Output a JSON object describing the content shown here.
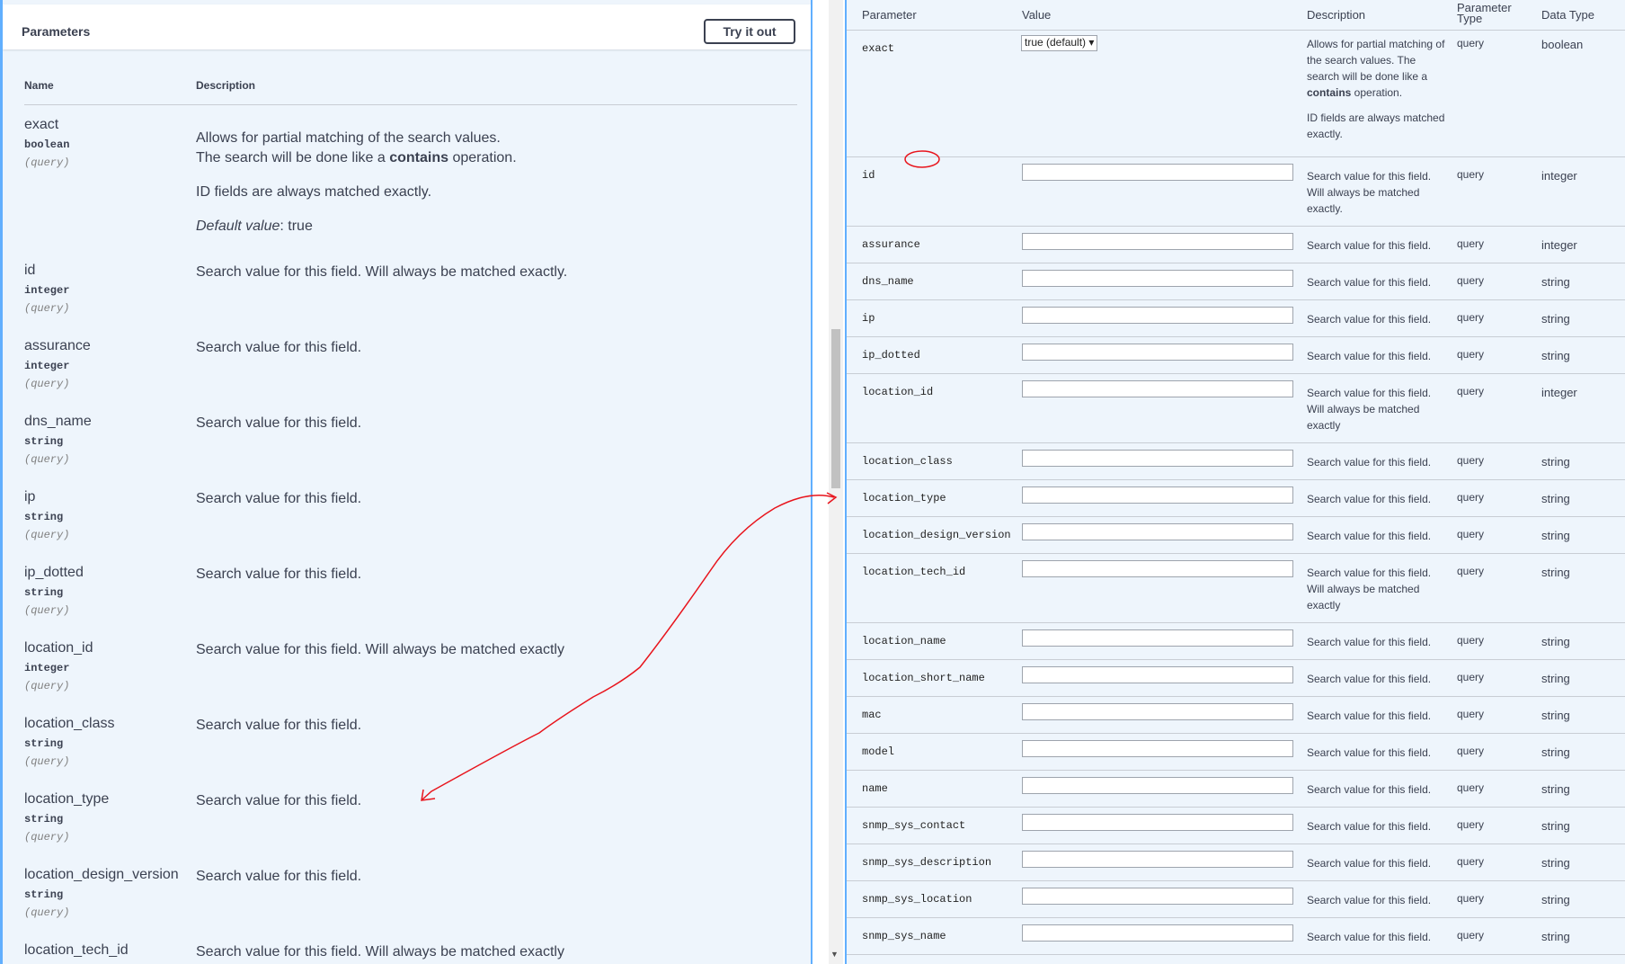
{
  "left": {
    "title": "Parameters",
    "try_button": "Try it out",
    "col_name": "Name",
    "col_description": "Description",
    "rows": [
      {
        "name": "exact",
        "type": "boolean",
        "in": "(query)",
        "desc1": "Allows for partial matching of the search values.",
        "desc2_pre": "The search will be done like a ",
        "desc2_bold": "contains",
        "desc2_post": " operation.",
        "desc3": "ID fields are always matched exactly.",
        "default_label": "Default value",
        "default_value": ": true"
      },
      {
        "name": "id",
        "type": "integer",
        "in": "(query)",
        "desc": "Search value for this field. Will always be matched exactly."
      },
      {
        "name": "assurance",
        "type": "integer",
        "in": "(query)",
        "desc": "Search value for this field."
      },
      {
        "name": "dns_name",
        "type": "string",
        "in": "(query)",
        "desc": "Search value for this field."
      },
      {
        "name": "ip",
        "type": "string",
        "in": "(query)",
        "desc": "Search value for this field."
      },
      {
        "name": "ip_dotted",
        "type": "string",
        "in": "(query)",
        "desc": "Search value for this field."
      },
      {
        "name": "location_id",
        "type": "integer",
        "in": "(query)",
        "desc": "Search value for this field. Will always be matched exactly"
      },
      {
        "name": "location_class",
        "type": "string",
        "in": "(query)",
        "desc": "Search value for this field."
      },
      {
        "name": "location_type",
        "type": "string",
        "in": "(query)",
        "desc": "Search value for this field."
      },
      {
        "name": "location_design_version",
        "type": "string",
        "in": "(query)",
        "desc": "Search value for this field."
      },
      {
        "name": "location_tech_id",
        "desc": "Search value for this field. Will always be matched exactly"
      }
    ]
  },
  "right": {
    "headers": {
      "parameter": "Parameter",
      "value": "Value",
      "description": "Description",
      "ptype": "Parameter Type",
      "dtype": "Data Type"
    },
    "exact": {
      "param": "exact",
      "select_value": "true (default) ▾",
      "desc1_pre": "Allows for partial matching of the search values. The search will be done like a ",
      "desc1_bold": "contains",
      "desc1_post": " operation.",
      "desc2": "ID fields are always matched exactly.",
      "ptype": "query",
      "dtype": "boolean"
    },
    "rows": [
      {
        "param": "id",
        "desc": "Search value for this field. Will always be matched exactly.",
        "ptype": "query",
        "dtype": "integer"
      },
      {
        "param": "assurance",
        "desc": "Search value for this field.",
        "ptype": "query",
        "dtype": "integer"
      },
      {
        "param": "dns_name",
        "desc": "Search value for this field.",
        "ptype": "query",
        "dtype": "string"
      },
      {
        "param": "ip",
        "desc": "Search value for this field.",
        "ptype": "query",
        "dtype": "string"
      },
      {
        "param": "ip_dotted",
        "desc": "Search value for this field.",
        "ptype": "query",
        "dtype": "string"
      },
      {
        "param": "location_id",
        "desc": "Search value for this field. Will always be matched exactly",
        "ptype": "query",
        "dtype": "integer"
      },
      {
        "param": "location_class",
        "desc": "Search value for this field.",
        "ptype": "query",
        "dtype": "string"
      },
      {
        "param": "location_type",
        "desc": "Search value for this field.",
        "ptype": "query",
        "dtype": "string"
      },
      {
        "param": "location_design_version",
        "desc": "Search value for this field.",
        "ptype": "query",
        "dtype": "string"
      },
      {
        "param": "location_tech_id",
        "desc": "Search value for this field. Will always be matched exactly",
        "ptype": "query",
        "dtype": "string"
      },
      {
        "param": "location_name",
        "desc": "Search value for this field.",
        "ptype": "query",
        "dtype": "string"
      },
      {
        "param": "location_short_name",
        "desc": "Search value for this field.",
        "ptype": "query",
        "dtype": "string"
      },
      {
        "param": "mac",
        "desc": "Search value for this field.",
        "ptype": "query",
        "dtype": "string"
      },
      {
        "param": "model",
        "desc": "Search value for this field.",
        "ptype": "query",
        "dtype": "string"
      },
      {
        "param": "name",
        "desc": "Search value for this field.",
        "ptype": "query",
        "dtype": "string"
      },
      {
        "param": "snmp_sys_contact",
        "desc": "Search value for this field.",
        "ptype": "query",
        "dtype": "string"
      },
      {
        "param": "snmp_sys_description",
        "desc": "Search value for this field.",
        "ptype": "query",
        "dtype": "string"
      },
      {
        "param": "snmp_sys_location",
        "desc": "Search value for this field.",
        "ptype": "query",
        "dtype": "string"
      },
      {
        "param": "snmp_sys_name",
        "desc": "Search value for this field.",
        "ptype": "query",
        "dtype": "string"
      }
    ]
  },
  "colors": {
    "accent": "#61affe",
    "panel_bg": "#eef5fc",
    "annotation": "#e8141c"
  },
  "icons": {
    "scroll_down": "scroll-down-arrow-icon"
  }
}
